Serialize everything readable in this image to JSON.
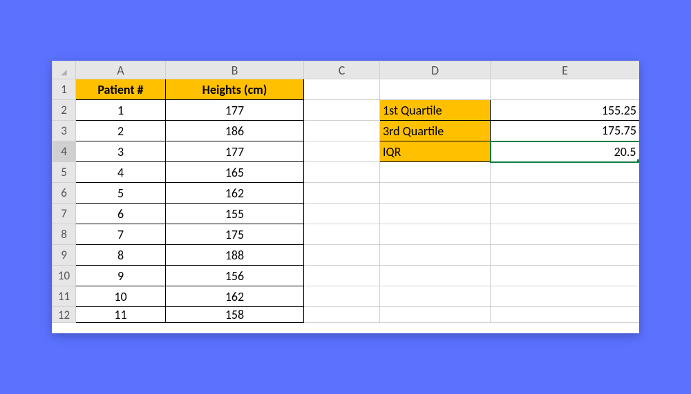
{
  "columns": {
    "A": "A",
    "B": "B",
    "C": "C",
    "D": "D",
    "E": "E"
  },
  "rows": [
    "1",
    "2",
    "3",
    "4",
    "5",
    "6",
    "7",
    "8",
    "9",
    "10",
    "11",
    "12"
  ],
  "table": {
    "header_A": "Patient #",
    "header_B": "Heights (cm)",
    "rows": [
      {
        "patient": "1",
        "height": "177"
      },
      {
        "patient": "2",
        "height": "186"
      },
      {
        "patient": "3",
        "height": "177"
      },
      {
        "patient": "4",
        "height": "165"
      },
      {
        "patient": "5",
        "height": "162"
      },
      {
        "patient": "6",
        "height": "155"
      },
      {
        "patient": "7",
        "height": "175"
      },
      {
        "patient": "8",
        "height": "188"
      },
      {
        "patient": "9",
        "height": "156"
      },
      {
        "patient": "10",
        "height": "162"
      },
      {
        "patient": "11",
        "height": "158"
      }
    ]
  },
  "stats": {
    "q1_label": "1st Quartile",
    "q1_value": "155.25",
    "q3_label": "3rd Quartile",
    "q3_value": "175.75",
    "iqr_label": "IQR",
    "iqr_value": "20.5"
  },
  "active_cell": "E4",
  "colors": {
    "accent": "#ffc000",
    "selection": "#107c41",
    "page_bg": "#5b72ff"
  }
}
